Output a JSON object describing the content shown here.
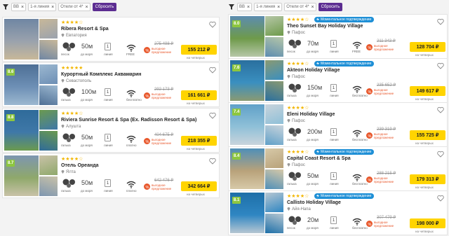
{
  "colors": {
    "accent": "#5c2d91",
    "rating_green": "#8dc63f",
    "price_yellow": "#ffd400",
    "deal_red": "#e8572b",
    "instant_blue": "#1e8fd6",
    "star": "#f2b600"
  },
  "left": {
    "filters": {
      "chips": [
        "ВВ",
        "1-я линия",
        "Отели от 4*"
      ],
      "reset_label": "Сбросить"
    },
    "hotels": [
      {
        "rating": "",
        "stars": "★★★★☆",
        "name": "Ribera Resort & Spa",
        "city": "Евпатория",
        "beach_label": "песок",
        "distance": "50м",
        "distance_label": "до моря",
        "line": "1",
        "line_label": "линия",
        "wifi_label": "FREE",
        "old_price": "275 498 ₽",
        "deal_text": "выгодное предложение",
        "price": "155 212 ₽",
        "price_sub": "на четверых",
        "photo_colors": [
          "#9aa2ad",
          "#c8b899",
          "#6f86a3"
        ]
      },
      {
        "rating": "8.6",
        "stars": "★★★★★",
        "name": "Курортный Комплекс Аквамарин",
        "city": "Севастополь",
        "beach_label": "галька",
        "distance": "100м",
        "distance_label": "до моря",
        "line": "1",
        "line_label": "линия",
        "wifi_label": "бесплатно",
        "old_price": "292 173 ₽",
        "deal_text": "выгодное предложение",
        "price": "161 661 ₽",
        "price_sub": "на четверых",
        "photo_colors": [
          "#6d8fb5",
          "#9cb8d0",
          "#4e6f95"
        ]
      },
      {
        "rating": "8.8",
        "stars": "★★★★☆",
        "name": "Riviera Sunrise Resort & Spa (Ex. Radisson Resort & Spa)",
        "city": "Алушта",
        "beach_label": "галька",
        "distance": "50м",
        "distance_label": "до моря",
        "line": "1",
        "line_label": "линия",
        "wifi_label": "платно",
        "old_price": "404 675 ₽",
        "deal_text": "выгодное предложение",
        "price": "218 355 ₽",
        "price_sub": "на четверых",
        "photo_colors": [
          "#3f78a8",
          "#6b9a4f",
          "#2f6b9a"
        ]
      },
      {
        "rating": "8.7",
        "stars": "★★★★☆",
        "name": "Отель Ореанда",
        "city": "Ялта",
        "beach_label": "галька",
        "distance": "50м",
        "distance_label": "до моря",
        "line": "1",
        "line_label": "линия",
        "wifi_label": "платно",
        "old_price": "642 476 ₽",
        "deal_text": "выгодное предложение",
        "price": "342 664 ₽",
        "price_sub": "на четверых",
        "photo_colors": [
          "#8fa86b",
          "#c9c2a8",
          "#7d96b0"
        ]
      }
    ]
  },
  "right": {
    "filters": {
      "chips": [
        "ВВ",
        "1-я линия",
        "Отели от 4*"
      ],
      "reset_label": "Сбросить"
    },
    "hotels": [
      {
        "rating": "8.0",
        "stars": "★★★★☆",
        "instant": "Моментальное подтверждение",
        "name": "Theo Sunset Bay Holiday Village",
        "city": "Пафос",
        "beach_label": "песок",
        "distance": "70м",
        "distance_label": "до моря",
        "line": "1",
        "line_label": "линия",
        "wifi_label": "FREE",
        "old_price": "211 343 ₽",
        "deal_text": "выгодное предложение",
        "price": "128 704 ₽",
        "price_sub": "на четверых",
        "photo_colors": [
          "#6e9a4a",
          "#b6c7a8",
          "#5c8cb0"
        ]
      },
      {
        "rating": "7.6",
        "stars": "★★★★☆",
        "instant": "Моментальное подтверждение",
        "name": "Akteon Holiday Village",
        "city": "Пафос",
        "beach_label": "галька",
        "distance": "150м",
        "distance_label": "до моря",
        "line": "1",
        "line_label": "линия",
        "wifi_label": "бесплатно",
        "old_price": "235 652 ₽",
        "deal_text": "выгодное предложение",
        "price": "149 617 ₽",
        "price_sub": "на четверых",
        "photo_colors": [
          "#3a8fc0",
          "#8a9a72",
          "#2a6f9e"
        ]
      },
      {
        "rating": "7.4",
        "stars": "★★★★☆",
        "instant": "",
        "name": "Eleni Holiday Village",
        "city": "Пафос",
        "beach_label": "галька",
        "distance": "200м",
        "distance_label": "до моря",
        "line": "1",
        "line_label": "линия",
        "wifi_label": "бесплатно",
        "old_price": "239 319 ₽",
        "deal_text": "выгодное предложение",
        "price": "155 725 ₽",
        "price_sub": "на четверых",
        "photo_colors": [
          "#8fc0d8",
          "#c9d4dc",
          "#5fa0c8"
        ]
      },
      {
        "rating": "8.4",
        "stars": "★★★★☆",
        "instant": "Моментальное подтверждение",
        "name": "Capital Coast Resort & Spa",
        "city": "Пафос",
        "beach_label": "галька",
        "distance": "50м",
        "distance_label": "до моря",
        "line": "1",
        "line_label": "линия",
        "wifi_label": "бесплатно",
        "old_price": "288 215 ₽",
        "deal_text": "выгодное предложение",
        "price": "179 313 ₽",
        "price_sub": "на четверых",
        "photo_colors": [
          "#b8a27a",
          "#d7c9a8",
          "#4f8fb8"
        ]
      },
      {
        "rating": "8.1",
        "stars": "★★★★☆",
        "instant": "Моментальное подтверждение",
        "name": "Callisto Holiday Village",
        "city": "Айя-Напа",
        "beach_label": "песок",
        "distance": "20м",
        "distance_label": "до моря",
        "line": "1",
        "line_label": "линия",
        "wifi_label": "бесплатно",
        "old_price": "307 479 ₽",
        "deal_text": "выгодное предложение",
        "price": "198 000 ₽",
        "price_sub": "на четверых",
        "photo_colors": [
          "#2f86c2",
          "#b7c7d2",
          "#1d6fa8"
        ]
      }
    ]
  }
}
